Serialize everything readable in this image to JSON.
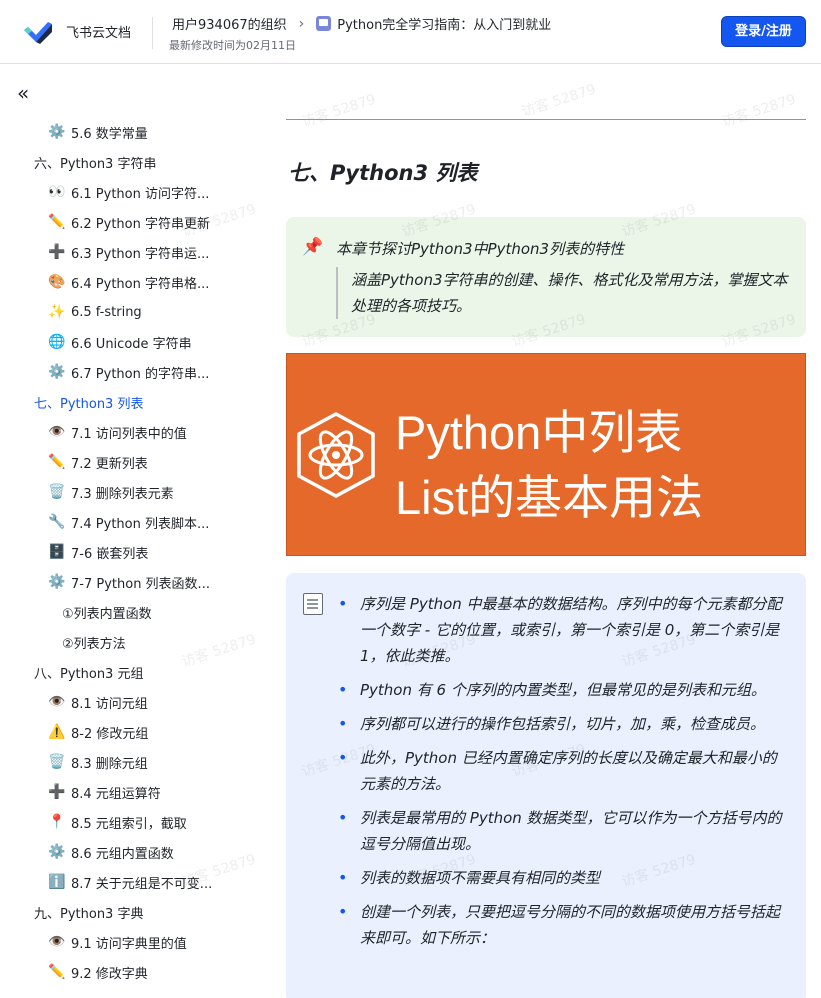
{
  "header": {
    "brand": "飞书云文档",
    "org": "用户934067的组织",
    "doc_title": "Python完全学习指南：从入门到就业",
    "modified": "最新修改时间为02月11日",
    "login_label": "登录/注册",
    "accent_color": "#1456f0"
  },
  "sidebar": {
    "collapse_icon": "«",
    "items": [
      {
        "icon": "⚙️",
        "label": "5.6 数学常量"
      },
      {
        "icon": "",
        "label": "六、Python3 字符串"
      },
      {
        "icon": "👀",
        "label": "6.1 Python 访问字符..."
      },
      {
        "icon": "✏️",
        "label": "6.2 Python 字符串更新"
      },
      {
        "icon": "➕",
        "label": "6.3 Python 字符串运..."
      },
      {
        "icon": "🎨",
        "label": "6.4 Python 字符串格..."
      },
      {
        "icon": "✨",
        "label": "6.5 f-string"
      },
      {
        "icon": "🌐",
        "label": "6.6 Unicode 字符串"
      },
      {
        "icon": "⚙️",
        "label": "6.7 Python 的字符串..."
      },
      {
        "icon": "",
        "label": "七、Python3 列表"
      },
      {
        "icon": "👁️",
        "label": "7.1 访问列表中的值"
      },
      {
        "icon": "✏️",
        "label": "7.2 更新列表"
      },
      {
        "icon": "🗑️",
        "label": "7.3 删除列表元素"
      },
      {
        "icon": "🔧",
        "label": "7.4 Python 列表脚本..."
      },
      {
        "icon": "🗄️",
        "label": "7-6 嵌套列表"
      },
      {
        "icon": "⚙️",
        "label": "7-7 Python 列表函数..."
      },
      {
        "icon": "",
        "label": "①列表内置函数"
      },
      {
        "icon": "",
        "label": "②列表方法"
      },
      {
        "icon": "",
        "label": "八、Python3 元组"
      },
      {
        "icon": "👁️",
        "label": "8.1 访问元组"
      },
      {
        "icon": "⚠️",
        "label": "8-2 修改元组"
      },
      {
        "icon": "🗑️",
        "label": "8.3 删除元组"
      },
      {
        "icon": "➕",
        "label": "8.4 元组运算符"
      },
      {
        "icon": "📍",
        "label": "8.5 元组索引，截取"
      },
      {
        "icon": "⚙️",
        "label": "8.6 元组内置函数"
      },
      {
        "icon": "ℹ️",
        "label": "8.7 关于元组是不可变..."
      },
      {
        "icon": "",
        "label": "九、Python3 字典"
      },
      {
        "icon": "👁️",
        "label": "9.1 访问字典里的值"
      },
      {
        "icon": "✏️",
        "label": "9.2 修改字典"
      }
    ]
  },
  "main": {
    "heading": "七、Python3 列表",
    "callout": {
      "title": "本章节探讨Python3中Python3列表的特性",
      "quote": "涵盖Python3字符串的创建、操作、格式化及常用方法，掌握文本处理的各项技巧。"
    },
    "banner": {
      "line1": "Python中列表",
      "line2": "List的基本用法",
      "bg_color": "#e4692a"
    },
    "bullets": [
      "序列是 Python 中最基本的数据结构。序列中的每个元素都分配一个数字 - 它的位置，或索引，第一个索引是 0，第二个索引是 1，依此类推。",
      "Python 有 6 个序列的内置类型，但最常见的是列表和元组。",
      "序列都可以进行的操作包括索引，切片，加，乘，检查成员。",
      "此外，Python 已经内置确定序列的长度以及确定最大和最小的元素的方法。",
      "列表是最常用的 Python 数据类型，它可以作为一个方括号内的逗号分隔值出现。",
      "列表的数据项不需要具有相同的类型",
      "创建一个列表，只要把逗号分隔的不同的数据项使用方括号括起来即可。如下所示："
    ]
  },
  "watermark": "访客 52879"
}
